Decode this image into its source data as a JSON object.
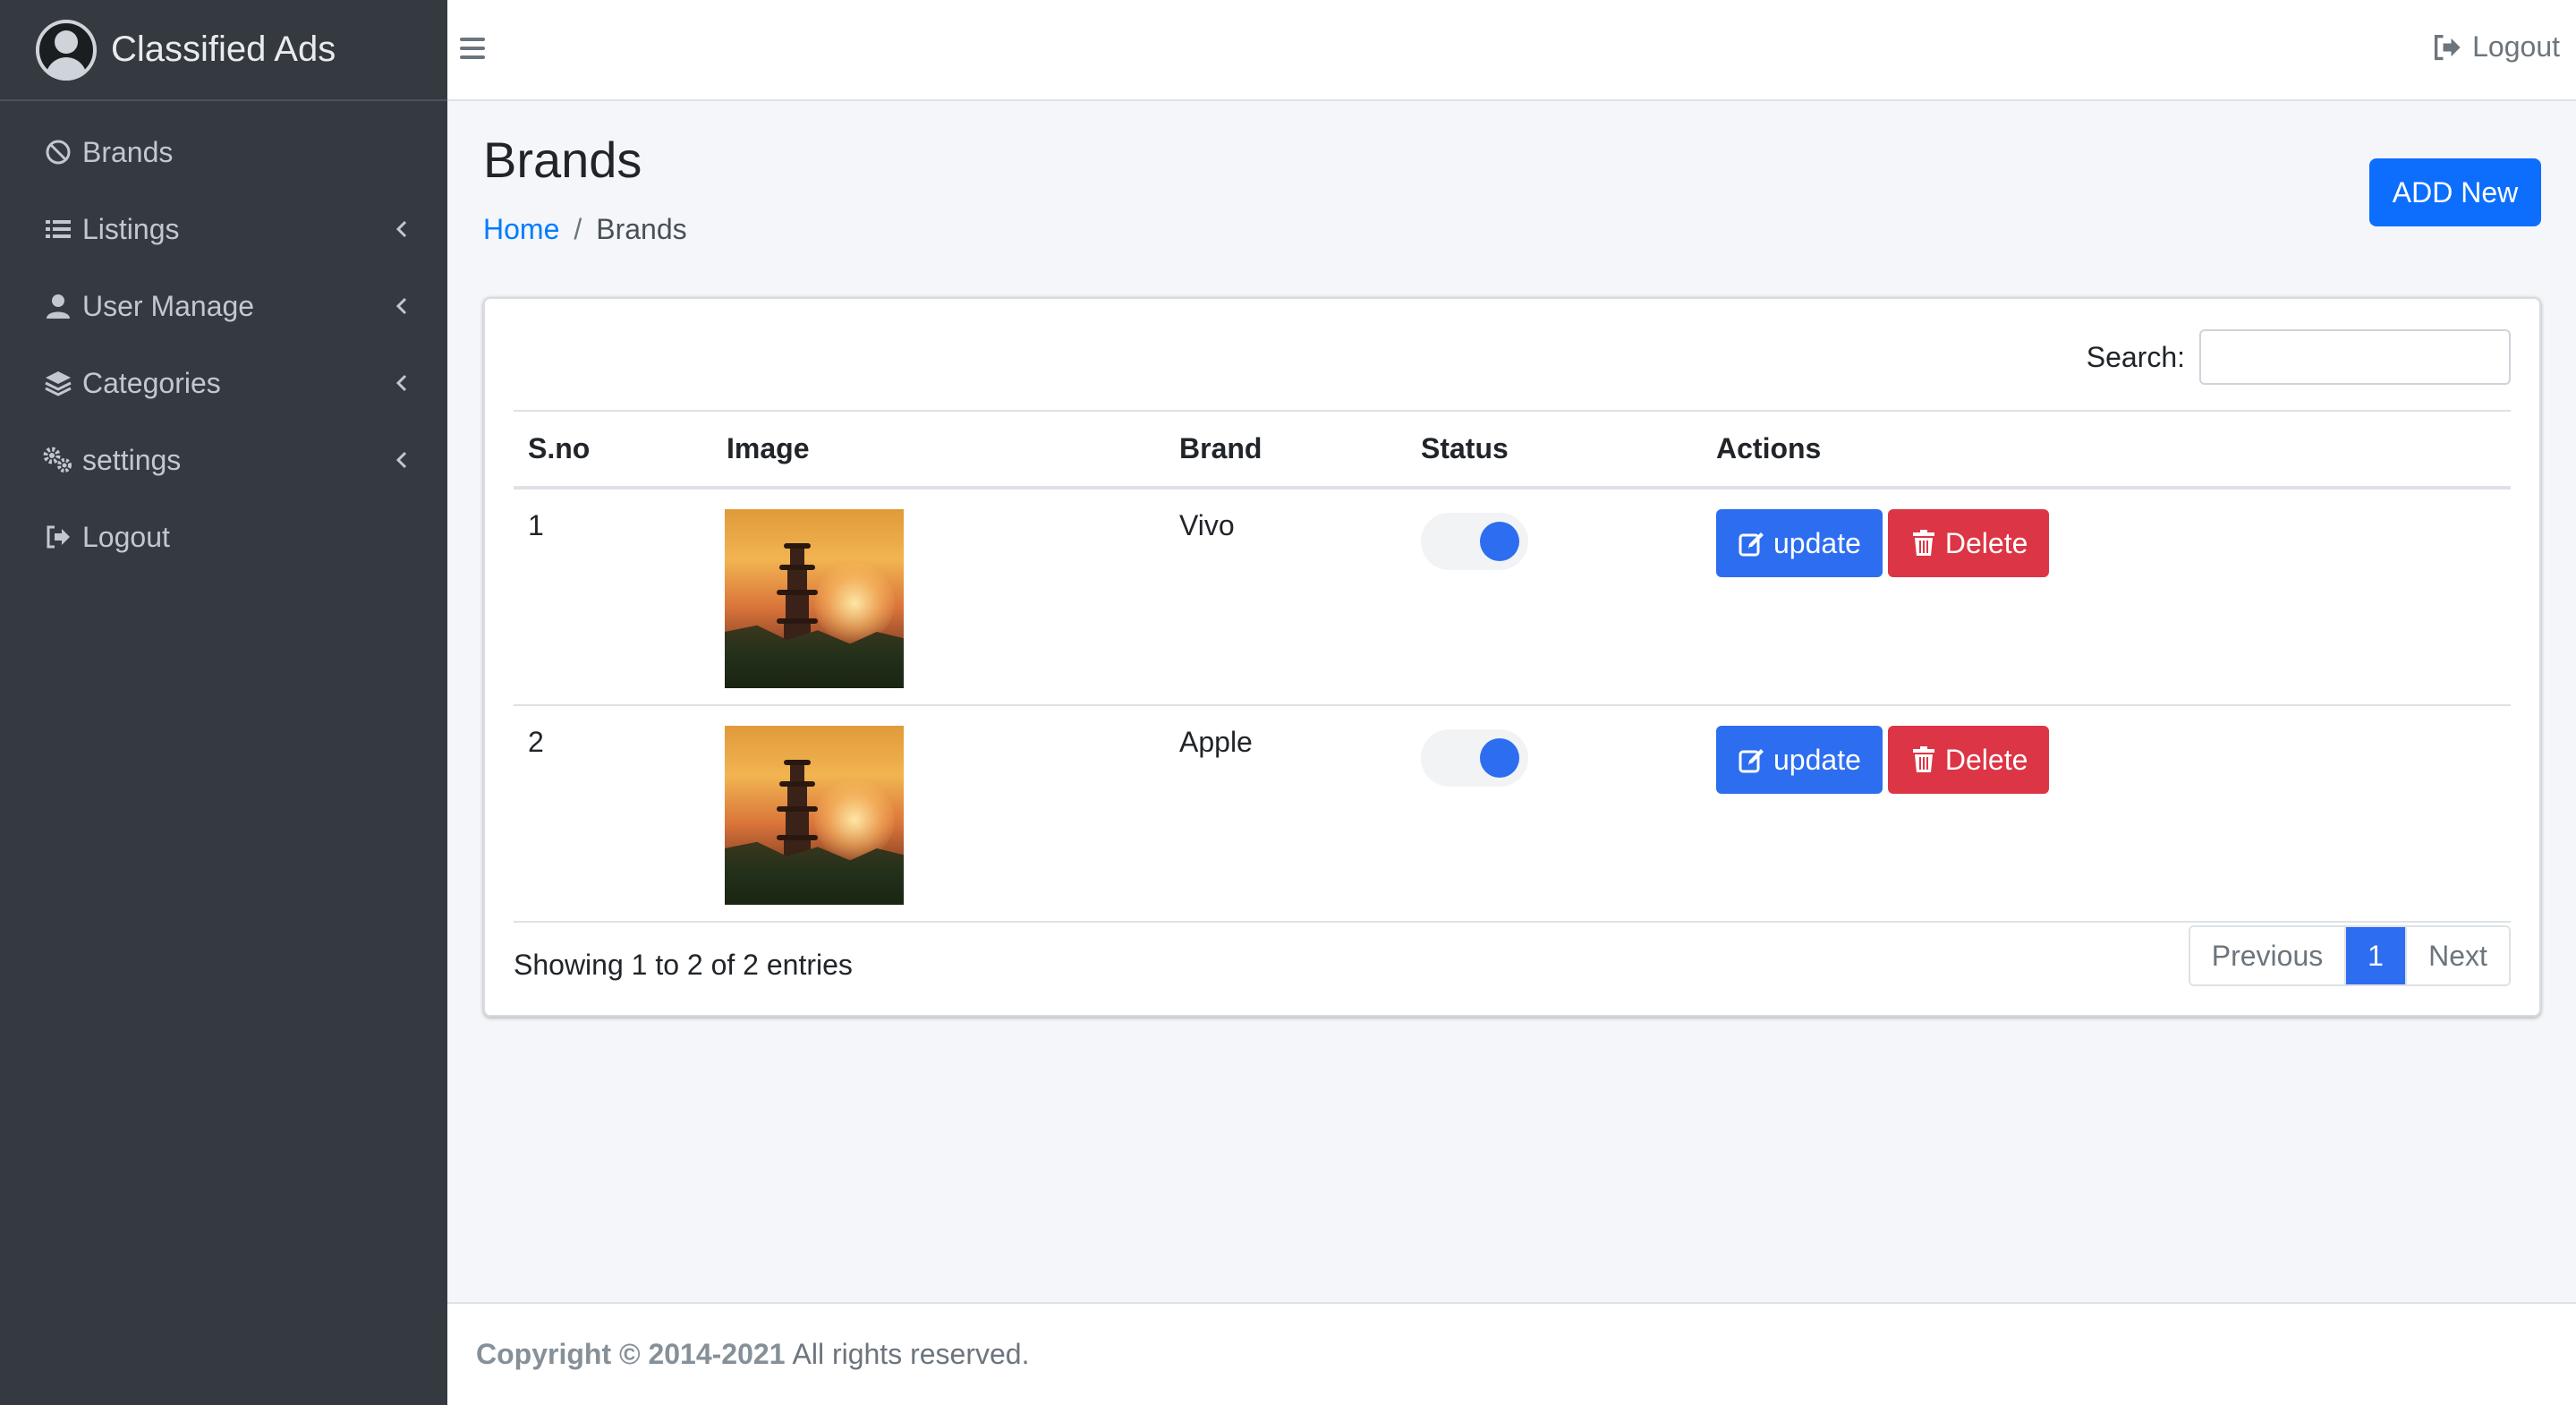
{
  "app": {
    "title": "Classified Ads"
  },
  "sidebar": {
    "items": [
      {
        "label": "Brands",
        "icon": "ban-icon"
      },
      {
        "label": "Listings",
        "icon": "list-icon"
      },
      {
        "label": "User Manage",
        "icon": "user-icon"
      },
      {
        "label": "Categories",
        "icon": "layers-icon"
      },
      {
        "label": "settings",
        "icon": "gears-icon"
      },
      {
        "label": "Logout",
        "icon": "sign-out-icon"
      }
    ]
  },
  "topbar": {
    "logout_label": "Logout"
  },
  "page": {
    "title": "Brands",
    "breadcrumb": {
      "home": "Home",
      "separator": "/",
      "current": "Brands"
    },
    "add_button": "ADD New"
  },
  "table": {
    "search_label": "Search:",
    "search_value": "",
    "columns": [
      "S.no",
      "Image",
      "Brand",
      "Status",
      "Actions"
    ],
    "rows": [
      {
        "sno": "1",
        "brand": "Vivo",
        "status": "active",
        "update_label": "update",
        "delete_label": "Delete"
      },
      {
        "sno": "2",
        "brand": "Apple",
        "status": "active",
        "update_label": "update",
        "delete_label": "Delete"
      }
    ],
    "info": "Showing 1 to 2 of 2 entries",
    "pagination": {
      "previous": "Previous",
      "current": "1",
      "next": "Next"
    }
  },
  "footer": {
    "copyright": "Copyright © 2014-2021",
    "rights": "All rights reserved."
  },
  "colors": {
    "sidebar": "#343a40",
    "primary": "#0d6efd",
    "danger": "#dc3545",
    "background": "#f4f6f9"
  }
}
